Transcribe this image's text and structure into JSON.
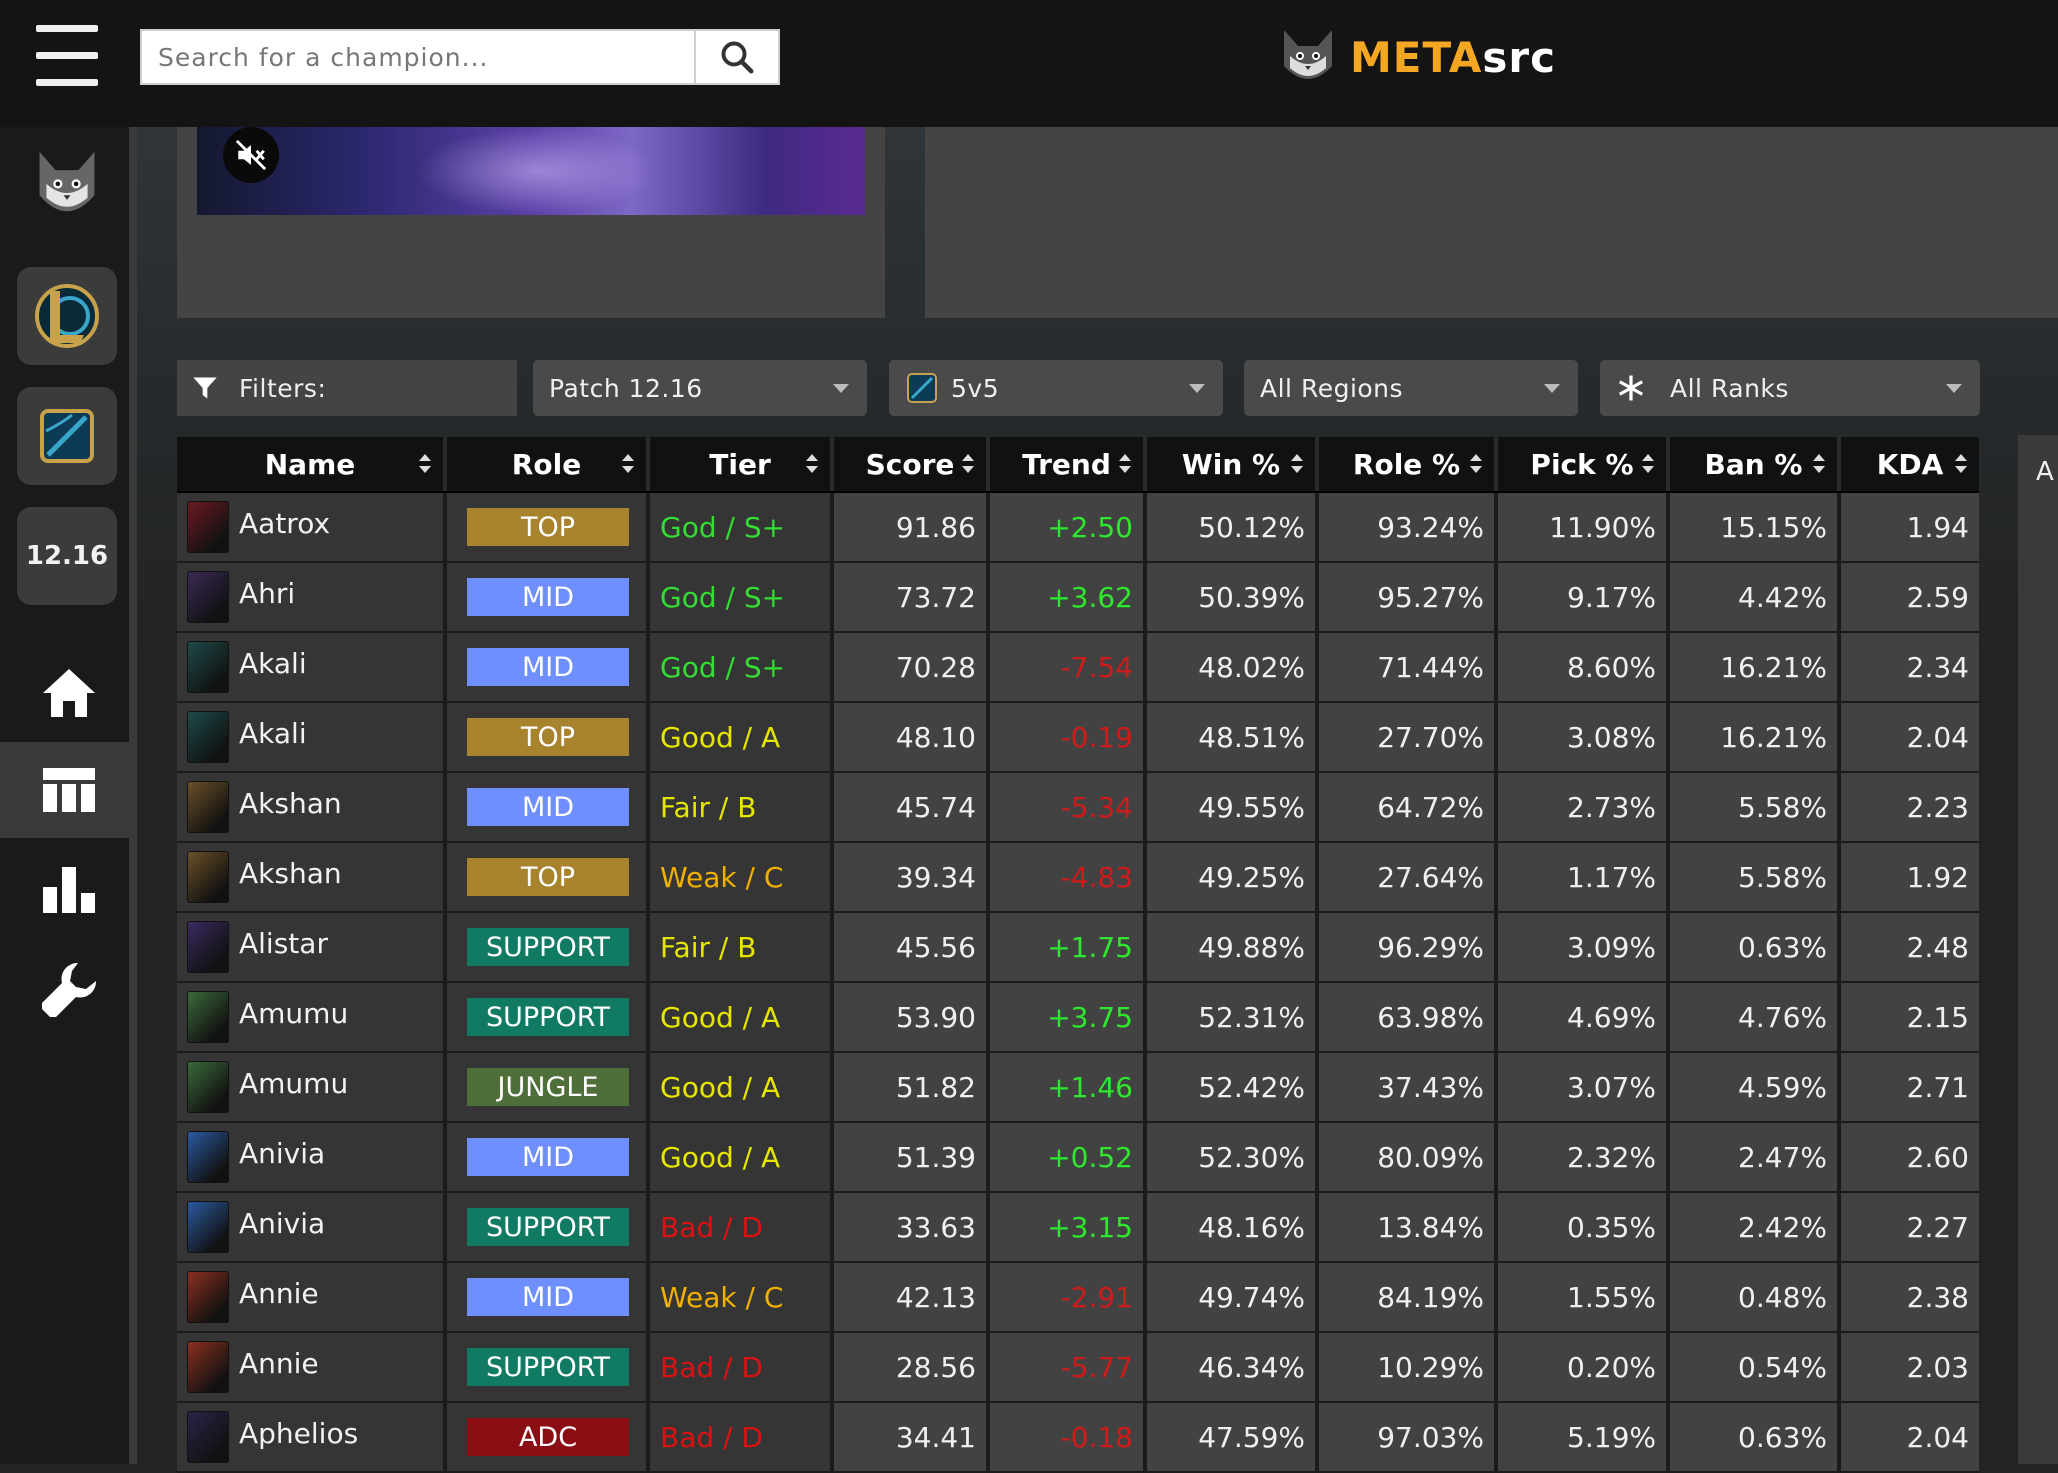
{
  "search": {
    "placeholder": "Search for a champion..."
  },
  "brand": {
    "name_primary": "META",
    "name_secondary": "src"
  },
  "sidebar": {
    "patch_label": "12.16"
  },
  "filters": {
    "label": "Filters:",
    "patch": "Patch 12.16",
    "mode": "5v5",
    "region": "All Regions",
    "rank": "All Ranks"
  },
  "side_stub_text": "A",
  "table": {
    "columns": [
      "Name",
      "Role",
      "Tier",
      "Score",
      "Trend",
      "Win %",
      "Role %",
      "Pick %",
      "Ban %",
      "KDA"
    ],
    "rows": [
      {
        "name": "Aatrox",
        "role": "TOP",
        "tier": "God / S+",
        "score": "91.86",
        "trend": "+2.50",
        "win": "50.12%",
        "role_pct": "93.24%",
        "pick": "11.90%",
        "ban": "15.15%",
        "kda": "1.94"
      },
      {
        "name": "Ahri",
        "role": "MID",
        "tier": "God / S+",
        "score": "73.72",
        "trend": "+3.62",
        "win": "50.39%",
        "role_pct": "95.27%",
        "pick": "9.17%",
        "ban": "4.42%",
        "kda": "2.59"
      },
      {
        "name": "Akali",
        "role": "MID",
        "tier": "God / S+",
        "score": "70.28",
        "trend": "-7.54",
        "win": "48.02%",
        "role_pct": "71.44%",
        "pick": "8.60%",
        "ban": "16.21%",
        "kda": "2.34"
      },
      {
        "name": "Akali",
        "role": "TOP",
        "tier": "Good / A",
        "score": "48.10",
        "trend": "-0.19",
        "win": "48.51%",
        "role_pct": "27.70%",
        "pick": "3.08%",
        "ban": "16.21%",
        "kda": "2.04"
      },
      {
        "name": "Akshan",
        "role": "MID",
        "tier": "Fair / B",
        "score": "45.74",
        "trend": "-5.34",
        "win": "49.55%",
        "role_pct": "64.72%",
        "pick": "2.73%",
        "ban": "5.58%",
        "kda": "2.23"
      },
      {
        "name": "Akshan",
        "role": "TOP",
        "tier": "Weak / C",
        "score": "39.34",
        "trend": "-4.83",
        "win": "49.25%",
        "role_pct": "27.64%",
        "pick": "1.17%",
        "ban": "5.58%",
        "kda": "1.92"
      },
      {
        "name": "Alistar",
        "role": "SUPPORT",
        "tier": "Fair / B",
        "score": "45.56",
        "trend": "+1.75",
        "win": "49.88%",
        "role_pct": "96.29%",
        "pick": "3.09%",
        "ban": "0.63%",
        "kda": "2.48"
      },
      {
        "name": "Amumu",
        "role": "SUPPORT",
        "tier": "Good / A",
        "score": "53.90",
        "trend": "+3.75",
        "win": "52.31%",
        "role_pct": "63.98%",
        "pick": "4.69%",
        "ban": "4.76%",
        "kda": "2.15"
      },
      {
        "name": "Amumu",
        "role": "JUNGLE",
        "tier": "Good / A",
        "score": "51.82",
        "trend": "+1.46",
        "win": "52.42%",
        "role_pct": "37.43%",
        "pick": "3.07%",
        "ban": "4.59%",
        "kda": "2.71"
      },
      {
        "name": "Anivia",
        "role": "MID",
        "tier": "Good / A",
        "score": "51.39",
        "trend": "+0.52",
        "win": "52.30%",
        "role_pct": "80.09%",
        "pick": "2.32%",
        "ban": "2.47%",
        "kda": "2.60"
      },
      {
        "name": "Anivia",
        "role": "SUPPORT",
        "tier": "Bad / D",
        "score": "33.63",
        "trend": "+3.15",
        "win": "48.16%",
        "role_pct": "13.84%",
        "pick": "0.35%",
        "ban": "2.42%",
        "kda": "2.27"
      },
      {
        "name": "Annie",
        "role": "MID",
        "tier": "Weak / C",
        "score": "42.13",
        "trend": "-2.91",
        "win": "49.74%",
        "role_pct": "84.19%",
        "pick": "1.55%",
        "ban": "0.48%",
        "kda": "2.38"
      },
      {
        "name": "Annie",
        "role": "SUPPORT",
        "tier": "Bad / D",
        "score": "28.56",
        "trend": "-5.77",
        "win": "46.34%",
        "role_pct": "10.29%",
        "pick": "0.20%",
        "ban": "0.54%",
        "kda": "2.03"
      },
      {
        "name": "Aphelios",
        "role": "ADC",
        "tier": "Bad / D",
        "score": "34.41",
        "trend": "-0.18",
        "win": "47.59%",
        "role_pct": "97.03%",
        "pick": "5.19%",
        "ban": "0.63%",
        "kda": "2.04"
      }
    ]
  },
  "colors": {
    "role_TOP": "#a8832e",
    "role_MID": "#6f8fff",
    "role_SUPPORT": "#117a62",
    "role_JUNGLE": "#4e6e3a",
    "role_ADC": "#8b0e14",
    "tier_God": "#33dd33",
    "tier_Good": "#e6e600",
    "tier_Fair": "#e6e600",
    "tier_Weak": "#f0b000",
    "tier_Bad": "#dd1111",
    "trend_up": "#2ee82e",
    "trend_down": "#d11a1a"
  },
  "icons": {
    "menu": "hamburger-icon",
    "search": "magnifier-icon",
    "mute": "volume-mute-icon",
    "filter": "funnel-icon",
    "rank": "asterisk-icon",
    "home": "home-icon",
    "table": "table-icon",
    "stats": "bar-chart-icon",
    "tools": "wrench-icon"
  }
}
